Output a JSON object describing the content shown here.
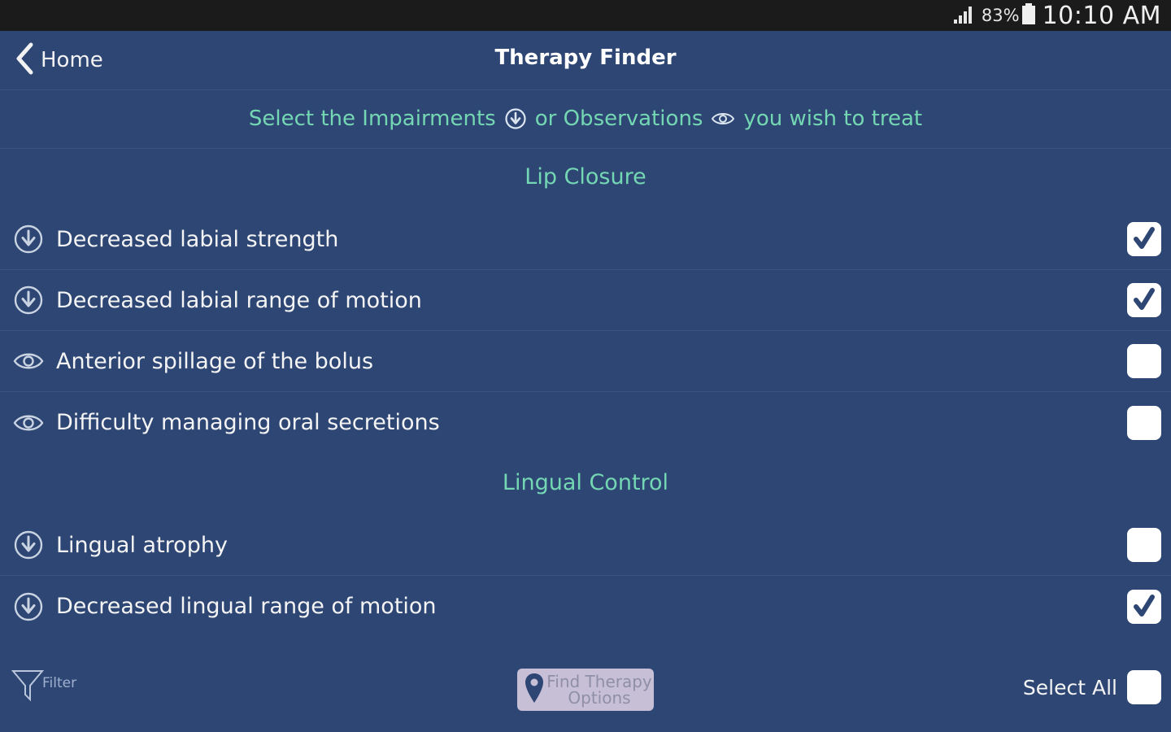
{
  "status_bar": {
    "battery_percent": "83%",
    "time": "10:10 AM",
    "icons": [
      "signal-icon",
      "battery-icon"
    ]
  },
  "nav": {
    "back_label": "Home",
    "title": "Therapy Finder"
  },
  "instruction": {
    "part1": "Select the Impairments",
    "part2": "or Observations",
    "part3": "you wish to treat"
  },
  "sections": [
    {
      "title": "Lip Closure",
      "items": [
        {
          "type": "impairment",
          "label": "Decreased labial strength",
          "checked": true
        },
        {
          "type": "impairment",
          "label": "Decreased labial range of motion",
          "checked": true
        },
        {
          "type": "observation",
          "label": "Anterior spillage of the bolus",
          "checked": false
        },
        {
          "type": "observation",
          "label": "Difficulty managing oral secretions",
          "checked": false
        }
      ]
    },
    {
      "title": "Lingual Control",
      "items": [
        {
          "type": "impairment",
          "label": "Lingual atrophy",
          "checked": false
        },
        {
          "type": "impairment",
          "label": "Decreased lingual range of motion",
          "checked": true
        }
      ]
    }
  ],
  "bottom": {
    "filter_label": "Filter",
    "find_button_line1": "Find Therapy",
    "find_button_line2": "Options",
    "select_all_label": "Select All",
    "select_all_checked": false
  },
  "colors": {
    "background": "#2e4674",
    "accent": "#74d7b3",
    "status_bar": "#1b1b1b",
    "checkmark": "#2e4674",
    "find_button": "#c7bfd6"
  }
}
